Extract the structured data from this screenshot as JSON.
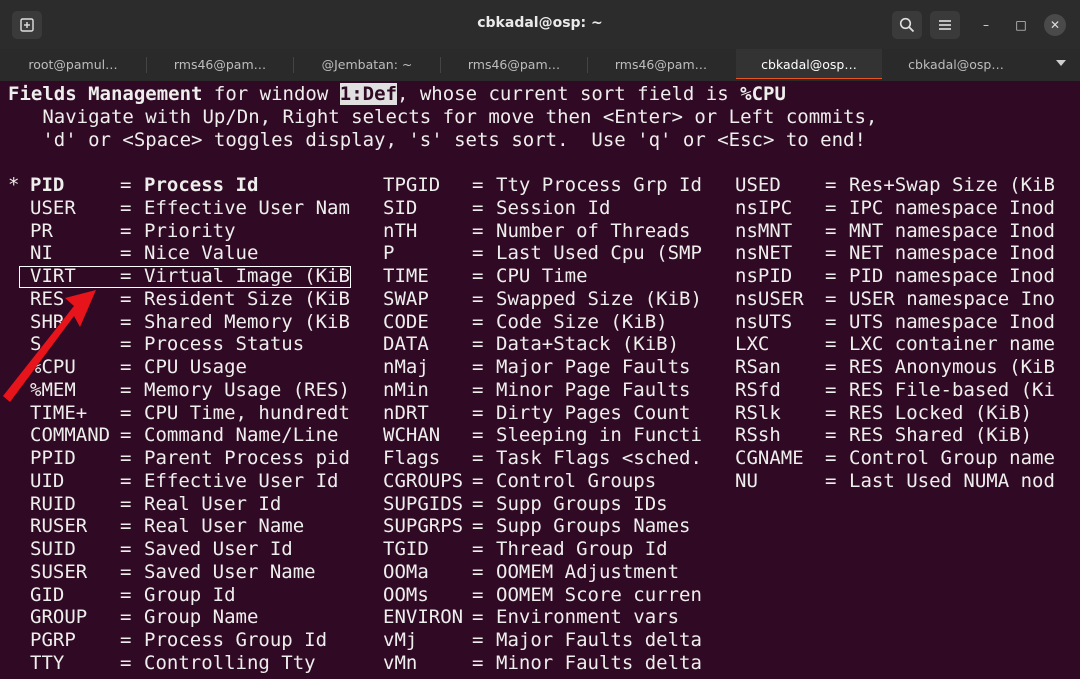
{
  "window": {
    "title": "cbkadal@osp: ~",
    "new_tab_icon": "terminal-plus-icon",
    "search_icon": "search-icon",
    "menu_icon": "hamburger-menu-icon",
    "minimize_glyph": "–",
    "maximize_glyph": "□",
    "close_glyph": "✕"
  },
  "tabs": [
    {
      "label": "root@pamul…"
    },
    {
      "label": "rms46@pam…"
    },
    {
      "label": "@Jembatan: ~"
    },
    {
      "label": "rms46@pam…"
    },
    {
      "label": "rms46@pam…"
    },
    {
      "label": "cbkadal@osp…",
      "active": true
    },
    {
      "label": "cbkadal@osp…"
    }
  ],
  "header": {
    "title": "Fields Management",
    "pre_window": " for window ",
    "window_name": "1:Def",
    "post_window": ", whose current sort field is ",
    "sort_field": "%CPU",
    "help_line1": "   Navigate with Up/Dn, Right selects for move then <Enter> or Left commits,",
    "help_line2": "   'd' or <Space> toggles display, 's' sets sort.  Use 'q' or <Esc> to end!"
  },
  "columns": [
    [
      {
        "mark": "*",
        "field": "PID",
        "desc": "Process Id",
        "bold": true
      },
      {
        "mark": " ",
        "field": "USER",
        "desc": "Effective User Nam"
      },
      {
        "mark": " ",
        "field": "PR",
        "desc": "Priority"
      },
      {
        "mark": " ",
        "field": "NI",
        "desc": "Nice Value"
      },
      {
        "mark": " ",
        "field": "VIRT",
        "desc": "Virtual Image (KiB",
        "selected": true
      },
      {
        "mark": " ",
        "field": "RES",
        "desc": "Resident Size (KiB"
      },
      {
        "mark": " ",
        "field": "SHR",
        "desc": "Shared Memory (KiB"
      },
      {
        "mark": " ",
        "field": "S",
        "desc": "Process Status"
      },
      {
        "mark": " ",
        "field": "%CPU",
        "desc": "CPU Usage"
      },
      {
        "mark": " ",
        "field": "%MEM",
        "desc": "Memory Usage (RES)"
      },
      {
        "mark": " ",
        "field": "TIME+",
        "desc": "CPU Time, hundredt"
      },
      {
        "mark": " ",
        "field": "COMMAND",
        "desc": "Command Name/Line"
      },
      {
        "mark": " ",
        "field": "PPID",
        "desc": "Parent Process pid"
      },
      {
        "mark": " ",
        "field": "UID",
        "desc": "Effective User Id"
      },
      {
        "mark": " ",
        "field": "RUID",
        "desc": "Real User Id"
      },
      {
        "mark": " ",
        "field": "RUSER",
        "desc": "Real User Name"
      },
      {
        "mark": " ",
        "field": "SUID",
        "desc": "Saved User Id"
      },
      {
        "mark": " ",
        "field": "SUSER",
        "desc": "Saved User Name"
      },
      {
        "mark": " ",
        "field": "GID",
        "desc": "Group Id"
      },
      {
        "mark": " ",
        "field": "GROUP",
        "desc": "Group Name"
      },
      {
        "mark": " ",
        "field": "PGRP",
        "desc": "Process Group Id"
      },
      {
        "mark": " ",
        "field": "TTY",
        "desc": "Controlling Tty"
      }
    ],
    [
      {
        "field": "TPGID",
        "desc": "Tty Process Grp Id"
      },
      {
        "field": "SID",
        "desc": "Session Id"
      },
      {
        "field": "nTH",
        "desc": "Number of Threads"
      },
      {
        "field": "P",
        "desc": "Last Used Cpu (SMP"
      },
      {
        "field": "TIME",
        "desc": "CPU Time"
      },
      {
        "field": "SWAP",
        "desc": "Swapped Size (KiB)"
      },
      {
        "field": "CODE",
        "desc": "Code Size (KiB)"
      },
      {
        "field": "DATA",
        "desc": "Data+Stack (KiB)"
      },
      {
        "field": "nMaj",
        "desc": "Major Page Faults"
      },
      {
        "field": "nMin",
        "desc": "Minor Page Faults"
      },
      {
        "field": "nDRT",
        "desc": "Dirty Pages Count"
      },
      {
        "field": "WCHAN",
        "desc": "Sleeping in Functi"
      },
      {
        "field": "Flags",
        "desc": "Task Flags <sched."
      },
      {
        "field": "CGROUPS",
        "desc": "Control Groups"
      },
      {
        "field": "SUPGIDS",
        "desc": "Supp Groups IDs"
      },
      {
        "field": "SUPGRPS",
        "desc": "Supp Groups Names"
      },
      {
        "field": "TGID",
        "desc": "Thread Group Id"
      },
      {
        "field": "OOMa",
        "desc": "OOMEM Adjustment"
      },
      {
        "field": "OOMs",
        "desc": "OOMEM Score curren"
      },
      {
        "field": "ENVIRON",
        "desc": "Environment vars"
      },
      {
        "field": "vMj",
        "desc": "Major Faults delta"
      },
      {
        "field": "vMn",
        "desc": "Minor Faults delta"
      }
    ],
    [
      {
        "field": "USED",
        "desc": "Res+Swap Size (KiB"
      },
      {
        "field": "nsIPC",
        "desc": "IPC namespace Inod"
      },
      {
        "field": "nsMNT",
        "desc": "MNT namespace Inod"
      },
      {
        "field": "nsNET",
        "desc": "NET namespace Inod"
      },
      {
        "field": "nsPID",
        "desc": "PID namespace Inod"
      },
      {
        "field": "nsUSER",
        "desc": "USER namespace Ino"
      },
      {
        "field": "nsUTS",
        "desc": "UTS namespace Inod"
      },
      {
        "field": "LXC",
        "desc": "LXC container name"
      },
      {
        "field": "RSan",
        "desc": "RES Anonymous (KiB"
      },
      {
        "field": "RSfd",
        "desc": "RES File-based (Ki"
      },
      {
        "field": "RSlk",
        "desc": "RES Locked (KiB)"
      },
      {
        "field": "RSsh",
        "desc": "RES Shared (KiB)"
      },
      {
        "field": "CGNAME",
        "desc": "Control Group name"
      },
      {
        "field": "NU",
        "desc": "Last Used NUMA nod"
      }
    ]
  ],
  "colors": {
    "terminal_bg": "#300a24",
    "text": "#eeeeec",
    "arrow": "#e8141c",
    "active_tab_accent": "#e95420"
  },
  "annotation": {
    "arrow_icon": "red-arrow-pointer-icon"
  }
}
